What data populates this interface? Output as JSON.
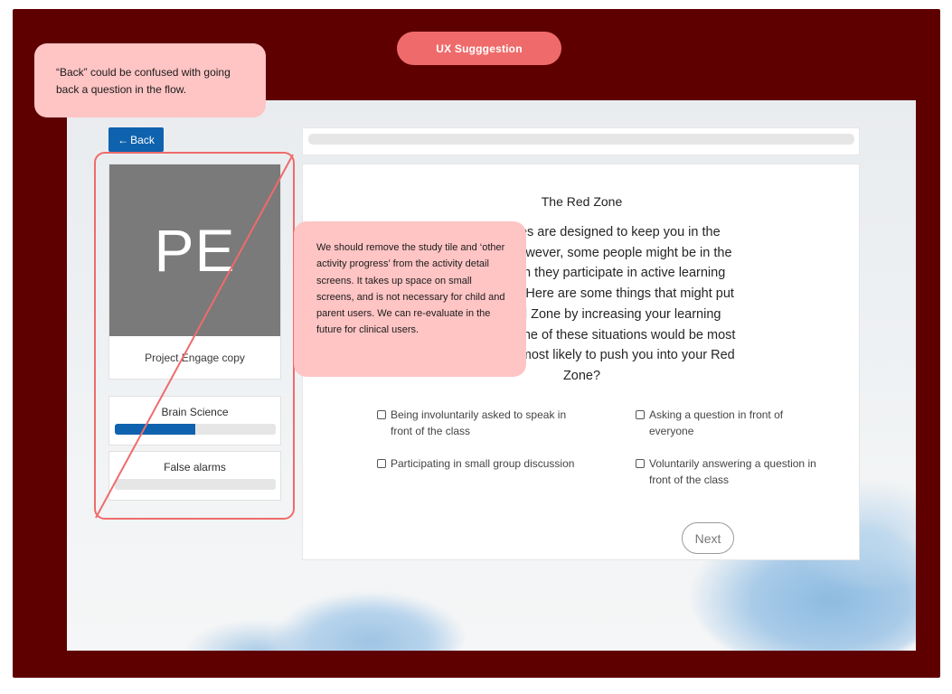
{
  "ux_suggestion_label": "UX Sugggestion",
  "annotations": {
    "back_note": "“Back” could be confused with going back a question in the flow.",
    "tile_note": "We should remove the study tile and ‘other activity progress’ from the activity detail screens. It takes up space on small screens, and is not necessary for child and parent users. We can re-evaluate in the future for clinical users."
  },
  "app": {
    "back_button": {
      "arrow": "←",
      "label": "Back"
    },
    "study_tile": {
      "initials": "PE",
      "caption": "Project Engage copy"
    },
    "activity_progress": [
      {
        "label": "Brain Science",
        "progress": 0.5
      },
      {
        "label": "False alarms",
        "progress": 0.0
      }
    ],
    "question": {
      "title": "The Red Zone",
      "body": "Biology classes are designed to keep you in the Green Zone. However, some people might be in the Red Zone when they participate in active learning biology classes. Here are some things that might put you in the Red Zone by increasing your learning anxiety. Which one of these situations would be most likely for you or most likely to push you into your Red Zone?",
      "options": [
        "Being involuntarily asked to speak in front of the class",
        "Asking a question in front of everyone",
        "Participating in small group discussion",
        "Voluntarily answering a question in front of the class"
      ],
      "next_label": "Next"
    }
  },
  "colors": {
    "frame": "#5e0000",
    "accent_pink": "#ef6b6b",
    "note_bg": "#ffc4c4",
    "primary_blue": "#0f62ad"
  }
}
